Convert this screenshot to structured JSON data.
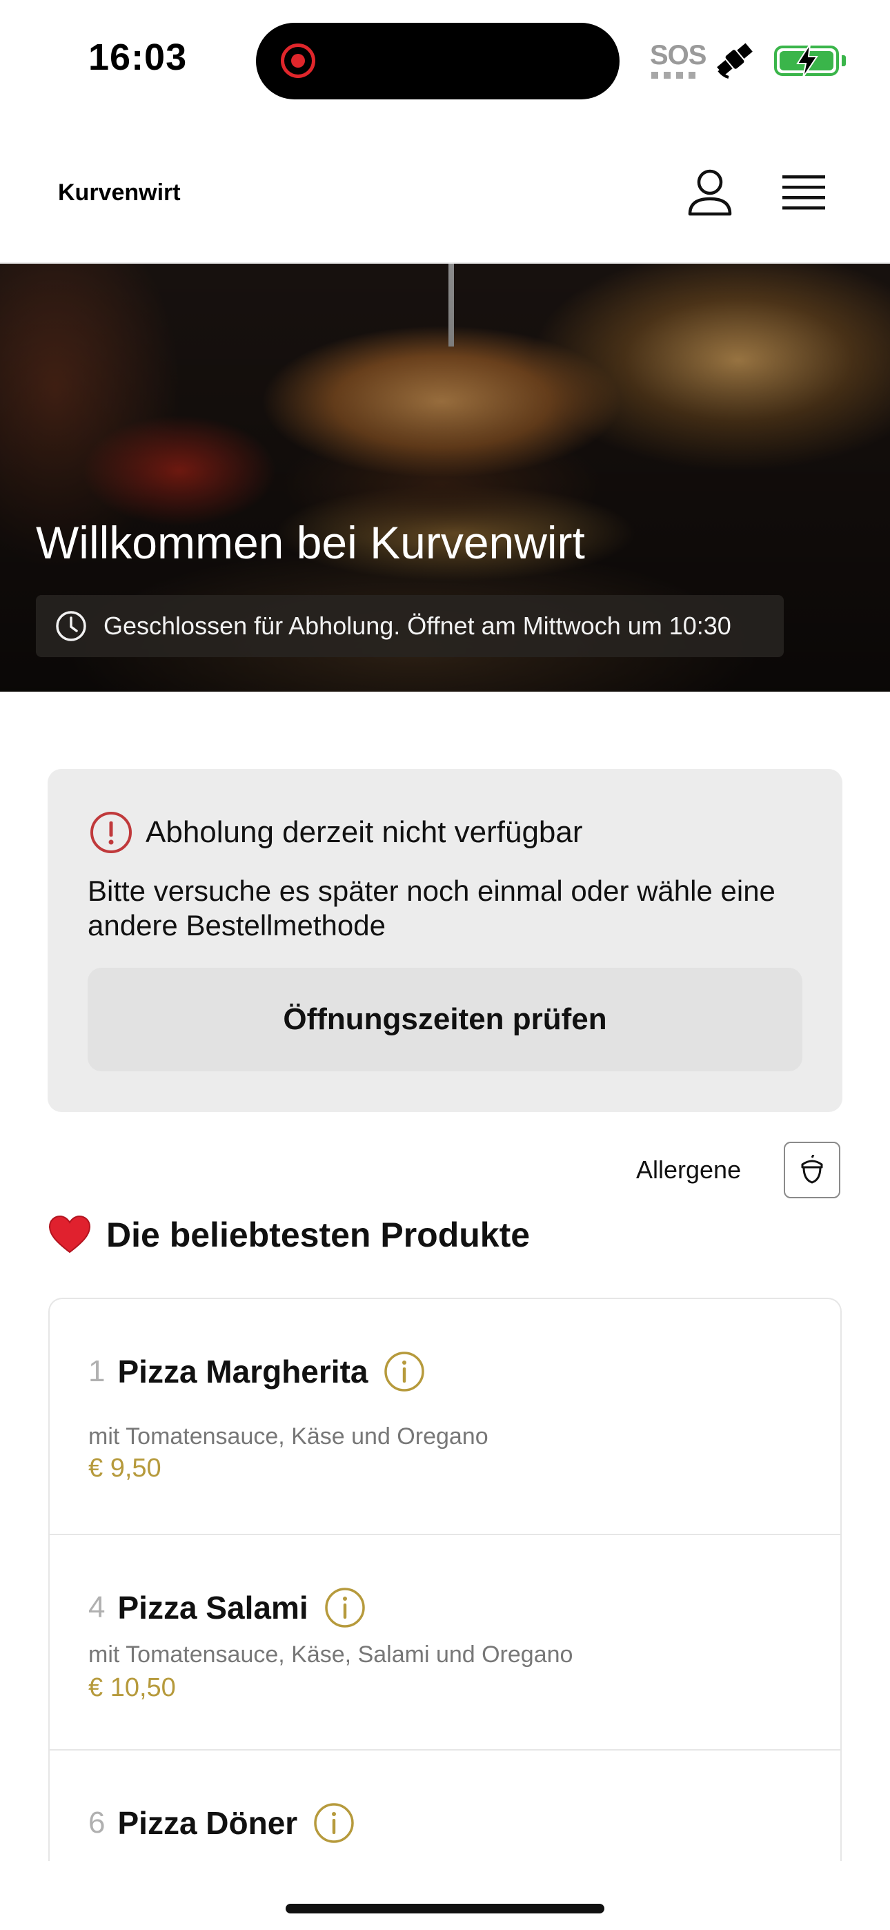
{
  "status_bar": {
    "time": "16:03",
    "sos": "SOS",
    "icons": [
      "screen-recording-icon",
      "satellite-icon",
      "battery-charging-icon"
    ],
    "recording_color": "#e0262b",
    "battery_color": "#3ab54a"
  },
  "header": {
    "brand": "Kurvenwirt",
    "icons": [
      "profile-icon",
      "hamburger-menu-icon"
    ]
  },
  "hero": {
    "title": "Willkommen bei Kurvenwirt",
    "status": "Geschlossen für Abholung. Öffnet am Mittwoch um 10:30",
    "status_icon": "clock-icon"
  },
  "notice": {
    "icon": "alert-circle-icon",
    "icon_color": "#c0393b",
    "title": "Abholung derzeit nicht verfügbar",
    "text": "Bitte versuche es später noch einmal oder wähle eine andere Bestellmethode",
    "button": "Öffnungszeiten prüfen"
  },
  "allergens": {
    "label": "Allergene",
    "icon": "acorn-icon"
  },
  "section": {
    "icon": "heart-icon",
    "title": "Die beliebtesten Produkte"
  },
  "products": [
    {
      "number": "1",
      "name": "Pizza Margherita",
      "description": "mit Tomatensauce, Käse und Oregano",
      "price": "€ 9,50"
    },
    {
      "number": "4",
      "name": "Pizza Salami",
      "description": "mit Tomatensauce, Käse, Salami und Oregano",
      "price": "€ 10,50"
    },
    {
      "number": "6",
      "name": "Pizza Döner"
    }
  ],
  "accent_color": "#b69a3c"
}
